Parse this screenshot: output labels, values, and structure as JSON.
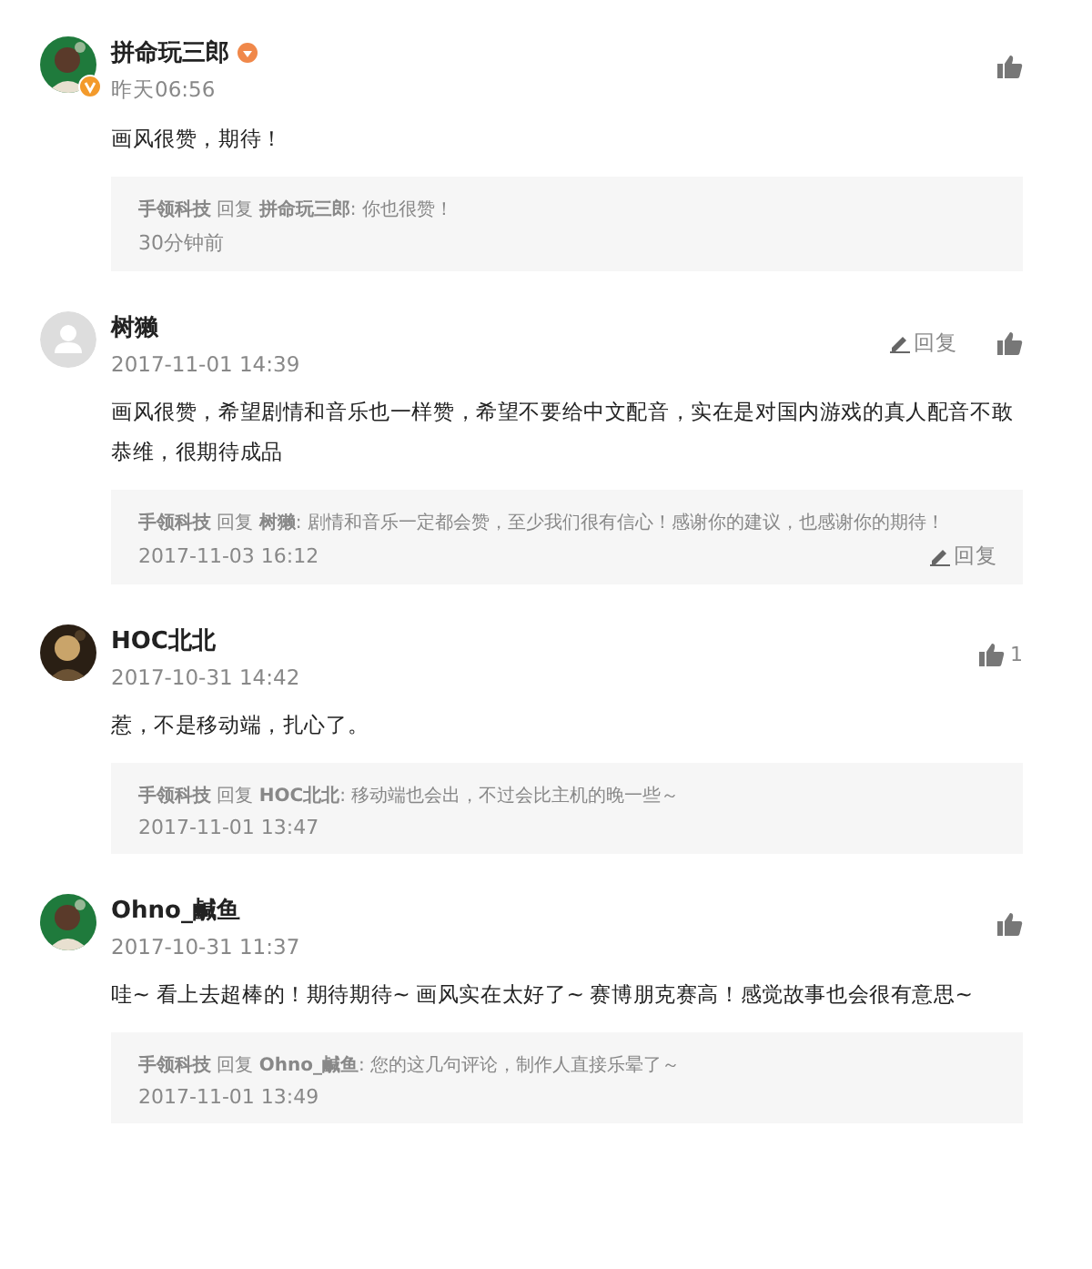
{
  "comments": [
    {
      "verified": true,
      "author": "拼命玩三郎",
      "time": "昨天06:56",
      "text": "画风很赞，期待！",
      "reply": {
        "text": "**手领科技** 回复 **拼命玩三郎**: 你也很赞！",
        "time": "30分钟前"
      }
    },
    {
      "avatar": {
        "kind": "default"
      },
      "verified": false,
      "author": "树獭",
      "time": "2017-11-01 14:39",
      "reply_action": "回复",
      "text": "画风很赞，希望剧情和音乐也一样赞，希望不要给中文配音，实在是对国内游戏的真人配音不敢恭维，很期待成品",
      "reply": {
        "text": "**手领科技** 回复 **树獭**: 剧情和音乐一定都会赞，至少我们很有信心！感谢你的建议，也感谢你的期待！",
        "time": "2017-11-03 16:12",
        "reply_action": "回复"
      }
    },
    {
      "verified": false,
      "author": "HOC北北",
      "time": "2017-10-31 14:42",
      "like_count": "1",
      "text": "惹，不是移动端，扎心了。",
      "reply": {
        "text": "**手领科技** 回复 **HOC北北**: 移动端也会出，不过会比主机的晚一些～",
        "time": "2017-11-01 13:47"
      }
    },
    {
      "verified": false,
      "author": "Ohno_鹹鱼",
      "time": "2017-10-31 11:37",
      "text": "哇~ 看上去超棒的！期待期待~ 画风实在太好了~ 赛博朋克赛高！感觉故事也会很有意思~",
      "reply": {
        "text": "**手领科技** 回复 **Ohno_鹹鱼**: 您的这几句评论，制作人直接乐晕了～",
        "time": "2017-11-01 13:49"
      }
    }
  ]
}
